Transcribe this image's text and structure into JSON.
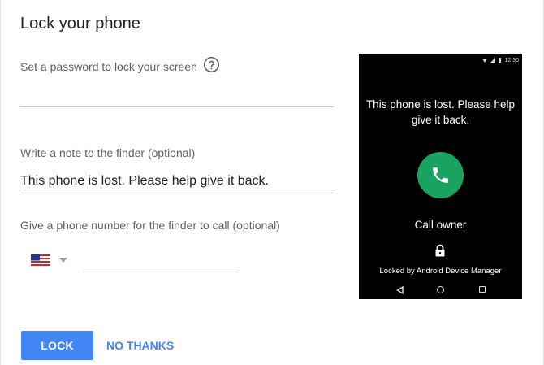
{
  "header": {
    "title": "Lock your phone"
  },
  "form": {
    "password_label": "Set a password to lock your screen",
    "password_help_icon": "help-circle-icon",
    "note_label": "Write a note to the finder (optional)",
    "note_value": "This phone is lost. Please help give it back.",
    "phone_label": "Give a phone number for the finder to call (optional)",
    "country_flag": "us-flag-icon",
    "phone_value": ""
  },
  "actions": {
    "lock_label": "LOCK",
    "no_thanks_label": "NO THANKS"
  },
  "preview": {
    "status_time": "12:30",
    "message": "This phone is lost. Please help give it back.",
    "call_owner_label": "Call owner",
    "locked_by_label": "Locked by Android Device Manager",
    "call_button_color": "#1aa260"
  },
  "colors": {
    "accent": "#4285f4",
    "call_green": "#1aa260"
  }
}
